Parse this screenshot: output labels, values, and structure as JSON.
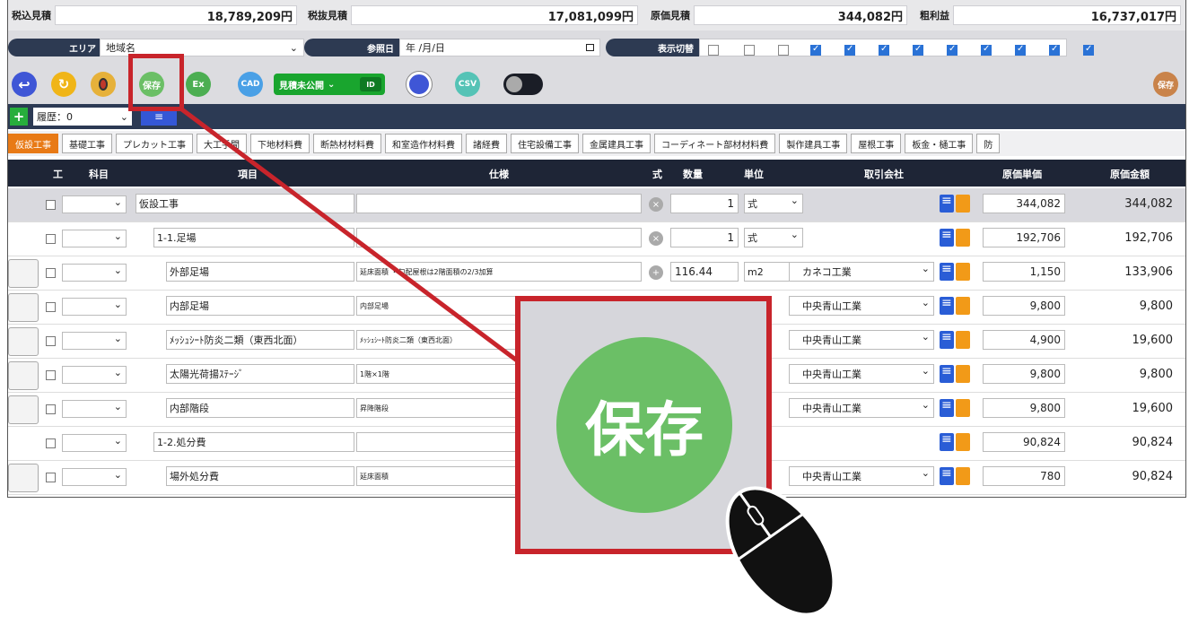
{
  "totals": {
    "tax_in_label": "税込見積",
    "tax_in_value": "18,789,209円",
    "tax_out_label": "税抜見積",
    "tax_out_value": "17,081,099円",
    "cost_label": "原価見積",
    "cost_value": "344,082円",
    "profit_label": "粗利益",
    "profit_value": "16,737,017円"
  },
  "filters": {
    "area_label": "エリア",
    "area_value": "地域名",
    "date_label": "参照日",
    "date_placeholder": "年 /月/日",
    "display_label": "表示切替",
    "checkboxes": [
      false,
      false,
      false,
      true,
      true,
      true,
      true,
      true,
      true,
      true,
      true,
      true
    ]
  },
  "toolbar": {
    "save_label": "保存",
    "excel_label": "Ex",
    "cad_label": "CAD",
    "estimate_label": "見積未公開",
    "estimate_sub": "ID",
    "csv_label": "CSV",
    "save_right_label": "保存",
    "colors": {
      "back": "#3f56d6",
      "undo": "#f0b518",
      "save": "#6bbf66",
      "excel": "#4cae52",
      "cad": "#4aa0e6",
      "csv": "#55c3b6",
      "save_right": "#c9834a"
    }
  },
  "history": {
    "label": "履歴：0",
    "button": "≡"
  },
  "tabs": [
    "仮設工事",
    "基礎工事",
    "プレカット工事",
    "大工手間",
    "下地材料費",
    "断熱材材料費",
    "和室造作材料費",
    "諸経費",
    "住宅設備工事",
    "金属建具工事",
    "コーディネート部材材料費",
    "製作建具工事",
    "屋根工事",
    "板金・樋工事",
    "防"
  ],
  "table": {
    "headers": {
      "work": "工",
      "subject": "科目",
      "item": "項目",
      "spec": "仕様",
      "formula": "式",
      "qty": "数量",
      "unit": "単位",
      "vendor": "取引会社",
      "unit_price": "原価単価",
      "cost_amount": "原価金額"
    },
    "rows": [
      {
        "item": "仮設工事",
        "spec": "",
        "qty": "1",
        "unit": "式",
        "vendor": "",
        "price": "344,082",
        "amount": "344,082"
      },
      {
        "item": "1-1.足場",
        "spec": "",
        "qty": "1",
        "unit": "式",
        "vendor": "",
        "price": "192,706",
        "amount": "192,706"
      },
      {
        "item": "外部足場",
        "spec": "延床面積 ・勾配屋根は2階面積の2/3加算",
        "qty": "116.44",
        "unit": "m2",
        "vendor": "カネコ工業",
        "price": "1,150",
        "amount": "133,906"
      },
      {
        "item": "内部足場",
        "spec": "内部足場",
        "qty": "",
        "unit": "",
        "vendor": "中央青山工業",
        "price": "9,800",
        "amount": "9,800"
      },
      {
        "item": "ﾒｯｼｭｼｰﾄ防炎二類（東西北面）",
        "spec": "ﾒｯｼｭｼｰﾄ防炎二類（東西北面）",
        "qty": "",
        "unit": "",
        "vendor": "中央青山工業",
        "price": "4,900",
        "amount": "19,600"
      },
      {
        "item": "太陽光荷揚ｽﾃｰｼﾞ",
        "spec": "1階×1階",
        "qty": "",
        "unit": "",
        "vendor": "中央青山工業",
        "price": "9,800",
        "amount": "9,800"
      },
      {
        "item": "内部階段",
        "spec": "昇降階段",
        "qty": "",
        "unit": "",
        "vendor": "中央青山工業",
        "price": "9,800",
        "amount": "19,600"
      },
      {
        "item": "1-2.処分費",
        "spec": "",
        "qty": "",
        "unit": "",
        "vendor": "",
        "price": "90,824",
        "amount": "90,824"
      },
      {
        "item": "場外処分費",
        "spec": "延床面積",
        "qty": "",
        "unit": "",
        "vendor": "中央青山工業",
        "price": "780",
        "amount": "90,824"
      }
    ]
  },
  "zoom": {
    "label": "保存"
  }
}
